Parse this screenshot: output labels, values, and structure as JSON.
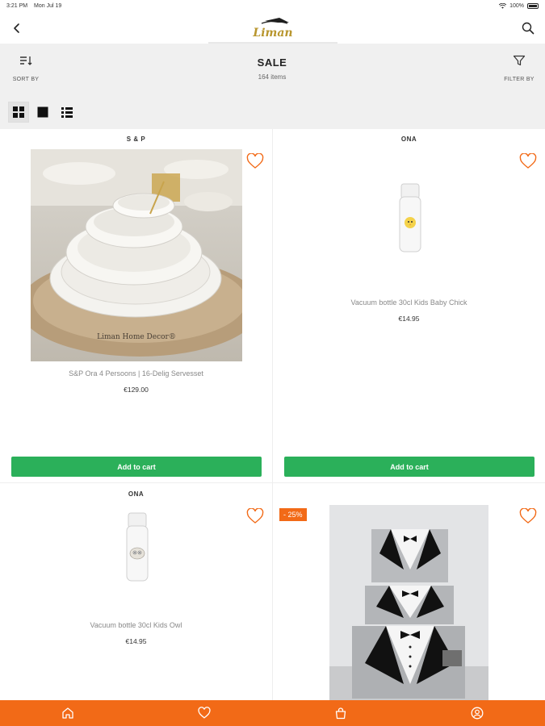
{
  "status_bar": {
    "time": "3:21 PM",
    "date": "Mon Jul 19",
    "battery": "100%"
  },
  "header": {
    "back_icon": "chevron-left-icon",
    "search_icon": "search-icon",
    "logo_text": "Liman"
  },
  "toolbar": {
    "sort_label": "SORT BY",
    "title": "SALE",
    "count": "164 items",
    "filter_label": "FILTER BY",
    "view_modes": [
      "grid-2-icon",
      "grid-1-icon",
      "list-icon"
    ],
    "active_view": "grid-2-icon"
  },
  "products": [
    {
      "brand": "S & P",
      "name": "S&P Ora 4 Persoons | 16-Delig Servesset",
      "price": "€129.00",
      "button": "Add to cart",
      "watermark": "Liman Home Decor®"
    },
    {
      "brand": "ONA",
      "name": "Vacuum bottle 30cl Kids Baby Chick",
      "price": "€14.95",
      "button": "Add to cart"
    },
    {
      "brand": "ONA",
      "name": "Vacuum bottle 30cl Kids Owl",
      "price": "€14.95"
    },
    {
      "brand": "",
      "badge": "- 25%"
    }
  ],
  "tab_bar": {
    "tabs": [
      "home-icon",
      "heart-icon",
      "bag-icon",
      "profile-icon"
    ]
  },
  "colors": {
    "accent": "#f26a17",
    "cart_button": "#2bb05a",
    "toolbar_bg": "#f0f0f0"
  }
}
